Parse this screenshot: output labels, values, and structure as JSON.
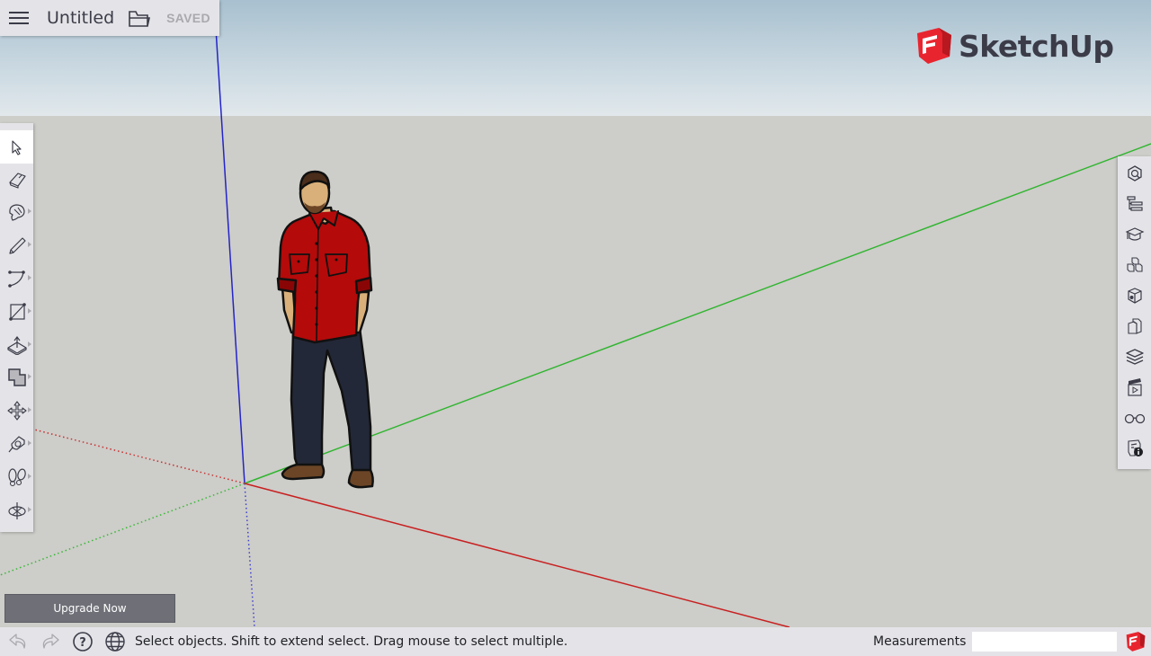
{
  "app": {
    "name": "SketchUp",
    "brand_color": "#e8252f",
    "document_title": "Untitled",
    "save_status": "SAVED"
  },
  "header": {
    "menu_icon": "hamburger-menu-icon",
    "open_icon": "folder-open-icon"
  },
  "left_toolbar": {
    "tools": [
      {
        "name": "Select",
        "icon": "select-arrow-icon",
        "active": true,
        "has_flyout": false
      },
      {
        "name": "Eraser",
        "icon": "eraser-icon",
        "active": false,
        "has_flyout": false
      },
      {
        "name": "Paint Bucket",
        "icon": "paint-bucket-icon",
        "active": false,
        "has_flyout": true
      },
      {
        "name": "Line",
        "icon": "pencil-icon",
        "active": false,
        "has_flyout": true
      },
      {
        "name": "Arc",
        "icon": "arc-icon",
        "active": false,
        "has_flyout": true
      },
      {
        "name": "Rectangle",
        "icon": "rectangle-icon",
        "active": false,
        "has_flyout": true
      },
      {
        "name": "Push/Pull",
        "icon": "push-pull-icon",
        "active": false,
        "has_flyout": true
      },
      {
        "name": "Offset",
        "icon": "offset-icon",
        "active": false,
        "has_flyout": true
      },
      {
        "name": "Move",
        "icon": "move-icon",
        "active": false,
        "has_flyout": true
      },
      {
        "name": "Tape Measure",
        "icon": "tape-measure-icon",
        "active": false,
        "has_flyout": true
      },
      {
        "name": "Walk",
        "icon": "footprints-icon",
        "active": false,
        "has_flyout": true
      },
      {
        "name": "Orbit",
        "icon": "orbit-icon",
        "active": false,
        "has_flyout": true
      }
    ]
  },
  "right_toolbar": {
    "panels": [
      {
        "name": "Entity Info",
        "icon": "entity-info-icon"
      },
      {
        "name": "Outliner",
        "icon": "outliner-icon"
      },
      {
        "name": "Instructor",
        "icon": "instructor-icon"
      },
      {
        "name": "Components",
        "icon": "components-icon"
      },
      {
        "name": "Materials",
        "icon": "materials-icon"
      },
      {
        "name": "Styles",
        "icon": "styles-icon"
      },
      {
        "name": "Layers",
        "icon": "layers-icon"
      },
      {
        "name": "Scenes",
        "icon": "scenes-icon"
      },
      {
        "name": "Display",
        "icon": "glasses-icon"
      },
      {
        "name": "Model Info",
        "icon": "model-info-icon"
      }
    ]
  },
  "scene": {
    "axes": {
      "red": "#cc2222",
      "green": "#2eb82e",
      "blue": "#2222cc"
    },
    "figure": "person-figure"
  },
  "upgrade_button": {
    "label": "Upgrade Now"
  },
  "statusbar": {
    "undo_icon": "undo-icon",
    "redo_icon": "redo-icon",
    "help_icon": "help-icon",
    "language_icon": "globe-icon",
    "status_text": "Select objects. Shift to extend select. Drag mouse to select multiple.",
    "measurements_label": "Measurements",
    "measurements_value": ""
  }
}
